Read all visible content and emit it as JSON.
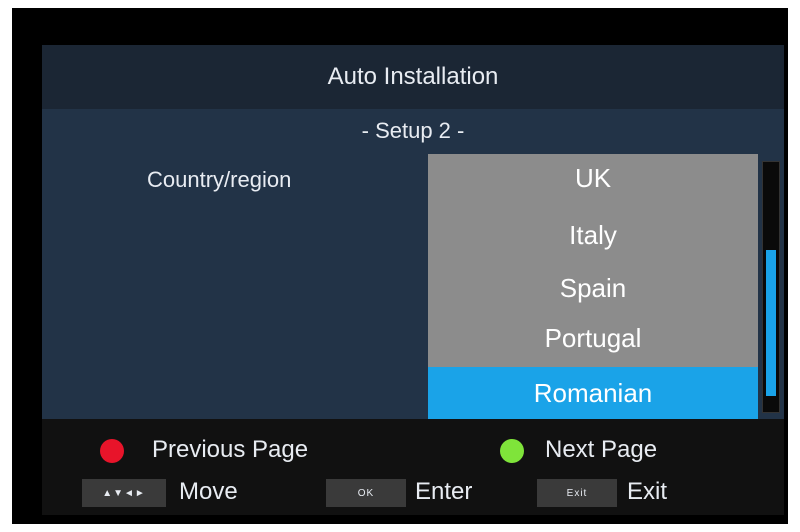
{
  "window": {
    "title": "Auto Installation"
  },
  "page": {
    "subtitle": "- Setup 2 -"
  },
  "field": {
    "label": "Country/region"
  },
  "dropdown": {
    "options": [
      "UK",
      "Italy",
      "Spain",
      "Portugal",
      "Romanian"
    ],
    "selected": "Romanian"
  },
  "footer": {
    "previous_page": "Previous Page",
    "next_page": "Next Page",
    "move": "Move",
    "enter": "Enter",
    "exit": "Exit",
    "arrows_key": "▲▼◄►",
    "ok_key": "OK",
    "exit_key": "Exit"
  },
  "colors": {
    "accent": "#1aa3e8",
    "red_button": "#e8142a",
    "green_button": "#7fe43a"
  }
}
